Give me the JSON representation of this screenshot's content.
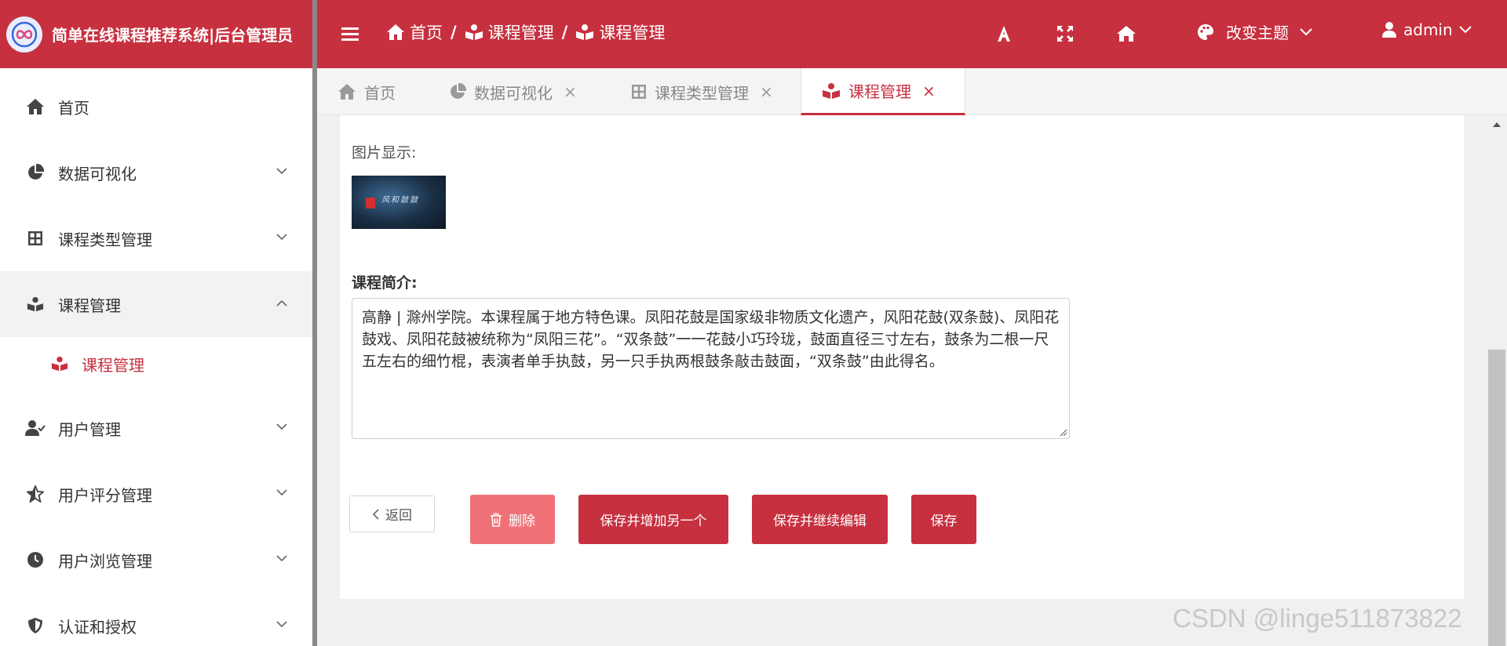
{
  "app": {
    "title": "简单在线课程推荐系统|后台管理员"
  },
  "breadcrumb": [
    "首页",
    "课程管理",
    "课程管理"
  ],
  "toolbar": {
    "theme_label": "改变主题",
    "user_label": "admin"
  },
  "sidebar": {
    "items": [
      {
        "label": "首页"
      },
      {
        "label": "数据可视化"
      },
      {
        "label": "课程类型管理"
      },
      {
        "label": "课程管理"
      },
      {
        "label": "用户管理"
      },
      {
        "label": "用户评分管理"
      },
      {
        "label": "用户浏览管理"
      },
      {
        "label": "认证和授权"
      }
    ],
    "sub_item": {
      "label": "课程管理"
    }
  },
  "tabs": [
    {
      "label": "首页"
    },
    {
      "label": "数据可视化"
    },
    {
      "label": "课程类型管理"
    },
    {
      "label": "课程管理"
    }
  ],
  "form": {
    "image_label": "图片显示:",
    "thumbnail_text": "风和鼓鼓",
    "intro_label": "课程简介:",
    "intro_text": "高静 | 滁州学院。本课程属于地方特色课。凤阳花鼓是国家级非物质文化遗产，风阳花鼓(双条鼓)、凤阳花鼓戏、凤阳花鼓被统称为“凤阳三花”。“双条鼓”一一花鼓小巧玲珑，鼓面直径三寸左右，鼓条为二根一尺五左右的细竹棍，表演者单手执鼓，另一只手执两根鼓条敲击鼓面，“双条鼓”由此得名。"
  },
  "buttons": {
    "back": "返回",
    "delete": "删除",
    "save_add": "保存并增加另一个",
    "save_continue": "保存并继续编辑",
    "save": "保存"
  },
  "watermark": "CSDN @linge511873822",
  "colors": {
    "primary": "#c7303f",
    "danger_light": "#f07277"
  }
}
